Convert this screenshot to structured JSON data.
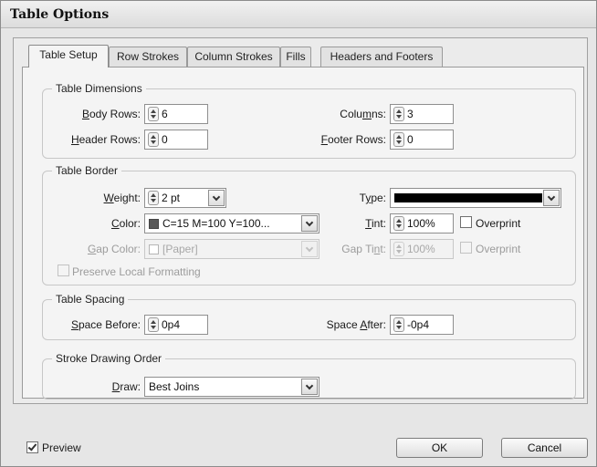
{
  "window": {
    "title": "Table Options"
  },
  "tabs": [
    {
      "label": "Table Setup"
    },
    {
      "label": "Row Strokes"
    },
    {
      "label": "Column Strokes"
    },
    {
      "label": "Fills"
    },
    {
      "label": "Headers and Footers"
    }
  ],
  "dimensions": {
    "legend": "Table Dimensions",
    "body_rows": {
      "label_pre": "",
      "label_key": "B",
      "label_post": "ody Rows:",
      "value": "6"
    },
    "columns": {
      "label_pre": "Colu",
      "label_key": "m",
      "label_post": "ns:",
      "value": "3"
    },
    "header_rows": {
      "label_pre": "",
      "label_key": "H",
      "label_post": "eader Rows:",
      "value": "0"
    },
    "footer_rows": {
      "label_pre": "",
      "label_key": "F",
      "label_post": "ooter Rows:",
      "value": "0"
    }
  },
  "border": {
    "legend": "Table Border",
    "weight": {
      "label_pre": "",
      "label_key": "W",
      "label_post": "eight:",
      "value": "2 pt"
    },
    "type": {
      "label_pre": "T",
      "label_key": "y",
      "label_post": "pe:",
      "swatch_color": "#000000"
    },
    "color": {
      "label_pre": "",
      "label_key": "C",
      "label_post": "olor:",
      "value": "C=15 M=100 Y=100...",
      "swatch_color": "#5a5a5a"
    },
    "tint": {
      "label_pre": "",
      "label_key": "T",
      "label_post": "int:",
      "value": "100%"
    },
    "overprint": {
      "label": "Overprint",
      "checked": false
    },
    "gap_color": {
      "label_pre": "",
      "label_key": "G",
      "label_post": "ap Color:",
      "value": "[Paper]"
    },
    "gap_tint": {
      "label_pre": "Gap Ti",
      "label_key": "n",
      "label_post": "t:",
      "value": "100%"
    },
    "gap_overprint": {
      "label": "Overprint",
      "checked": false
    },
    "preserve": {
      "label": "Preserve Local Formatting",
      "checked": false
    }
  },
  "spacing": {
    "legend": "Table Spacing",
    "space_before": {
      "label_pre": "",
      "label_key": "S",
      "label_post": "pace Before:",
      "value": "0p4"
    },
    "space_after": {
      "label_pre": "Space ",
      "label_key": "A",
      "label_post": "fter:",
      "value": "-0p4"
    }
  },
  "order": {
    "legend": "Stroke Drawing Order",
    "draw": {
      "label_pre": "",
      "label_key": "D",
      "label_post": "raw:",
      "value": "Best Joins"
    }
  },
  "footer": {
    "preview": {
      "label": "Preview",
      "checked": true
    },
    "ok": "OK",
    "cancel": "Cancel"
  }
}
